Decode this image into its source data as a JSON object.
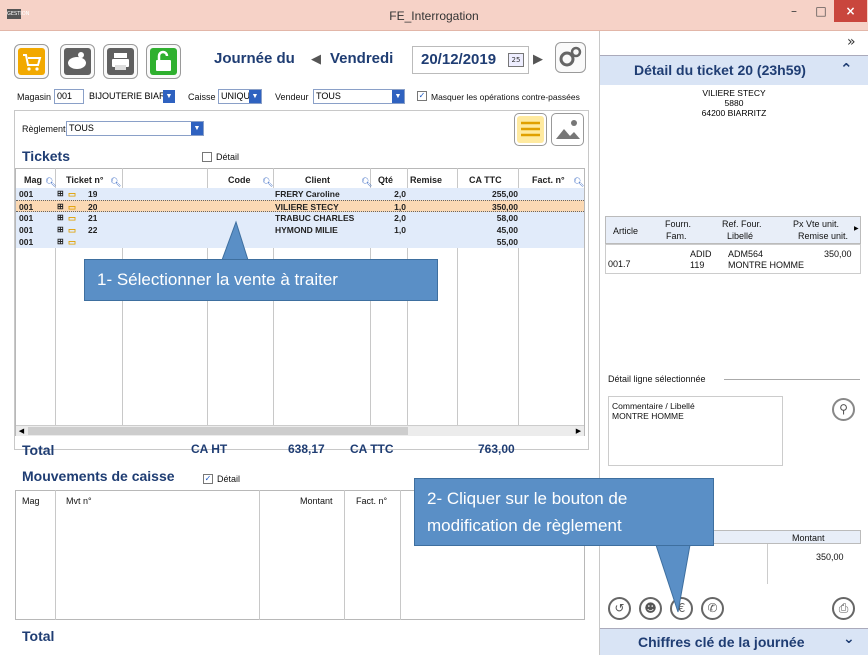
{
  "window": {
    "title": "FE_Interrogation",
    "app_icon": "GESTION",
    "min": "–",
    "max": "□",
    "close": "×"
  },
  "toolbar": {
    "day_label": "Journée du",
    "day_name": "Vendredi",
    "date": "20/12/2019"
  },
  "filters": {
    "magasin_label": "Magasin",
    "magasin_code": "001",
    "magasin_name": "BIJOUTERIE BIARR",
    "caisse_label": "Caisse",
    "caisse_value": "UNIQUI",
    "vendeur_label": "Vendeur",
    "vendeur_value": "TOUS",
    "masquer_label": "Masquer les opérations contre-passées",
    "reglement_label": "Règlement",
    "reglement_value": "TOUS"
  },
  "tickets": {
    "title": "Tickets",
    "detail_label": "Détail",
    "columns": {
      "mag": "Mag",
      "ticket": "Ticket n°",
      "code": "Code",
      "client": "Client",
      "qte": "Qté",
      "remise": "Remise",
      "ca_ttc": "CA TTC",
      "fact": "Fact. n°"
    },
    "rows": [
      {
        "mag": "001",
        "ticket": "19",
        "client": "FRERY Caroline",
        "qte": "2,0",
        "ca": "255,00"
      },
      {
        "mag": "001",
        "ticket": "20",
        "client": "VILIERE STECY",
        "qte": "1,0",
        "ca": "350,00"
      },
      {
        "mag": "001",
        "ticket": "21",
        "client": "TRABUC CHARLES",
        "qte": "2,0",
        "ca": "58,00"
      },
      {
        "mag": "001",
        "ticket": "22",
        "client": "HYMOND MILIE",
        "qte": "1,0",
        "ca": "45,00"
      },
      {
        "mag": "001",
        "ticket": "",
        "client": "",
        "qte": "",
        "ca": "55,00"
      }
    ]
  },
  "totals": {
    "label": "Total",
    "ca_ht_label": "CA HT",
    "ca_ht": "638,17",
    "ca_ttc_label": "CA TTC",
    "ca_ttc": "763,00"
  },
  "mouvements": {
    "title": "Mouvements de caisse",
    "detail_label": "Détail",
    "columns": {
      "mag": "Mag",
      "mvt": "Mvt n°",
      "montant": "Montant",
      "fact": "Fact. n°"
    },
    "total_label": "Total"
  },
  "callouts": {
    "one": "1- Sélectionner la vente à traiter",
    "two": "2- Cliquer sur le bouton de modification de règlement"
  },
  "right": {
    "expand": "»",
    "header": "Détail du ticket 20 (23h59)",
    "client_name": "VILIERE STECY",
    "client_num": "5880",
    "client_city": "64200 BIARRITZ",
    "columns": {
      "article": "Article",
      "fourn": "Fourn.",
      "fam": "Fam.",
      "ref": "Ref. Four.",
      "libelle": "Libellé",
      "px": "Px Vte unit.",
      "remise": "Remise unit."
    },
    "line": {
      "article": "001.7",
      "fourn": "ADID",
      "fam": "119",
      "ref": "ADM564",
      "libelle": "MONTRE HOMME",
      "px": "350,00"
    },
    "detail_label": "Détail ligne sélectionnée",
    "comment_label": "Commentaire / Libellé",
    "comment_value": "MONTRE HOMME",
    "montant_label": "Montant",
    "montant_value": "350,00",
    "footer": "Chiffres clé de la journée"
  }
}
